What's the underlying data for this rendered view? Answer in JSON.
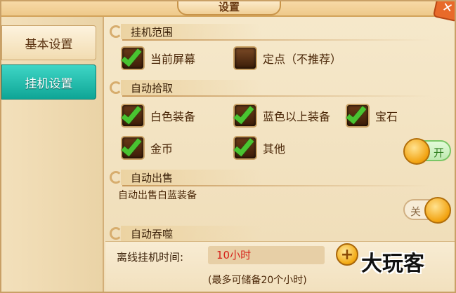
{
  "window": {
    "title": "设置",
    "close_icon": "close-icon"
  },
  "sidebar": {
    "tabs": [
      {
        "label": "基本设置",
        "active": false
      },
      {
        "label": "挂机设置",
        "active": true
      }
    ]
  },
  "sections": {
    "range": {
      "title": "挂机范围",
      "options": [
        {
          "label": "当前屏幕",
          "checked": true
        },
        {
          "label": "定点（不推荐）",
          "checked": false
        }
      ]
    },
    "pickup": {
      "title": "自动拾取",
      "options": [
        {
          "label": "白色装备",
          "checked": true
        },
        {
          "label": "蓝色以上装备",
          "checked": true
        },
        {
          "label": "宝石",
          "checked": true
        },
        {
          "label": "金币",
          "checked": true
        },
        {
          "label": "其他",
          "checked": true
        }
      ],
      "toggle": {
        "label": "开",
        "state": "on"
      }
    },
    "sell": {
      "title": "自动出售",
      "description": "自动出售白蓝装备",
      "toggle": {
        "label": "关",
        "state": "off"
      }
    },
    "devour": {
      "title": "自动吞噬"
    }
  },
  "offline": {
    "label": "离线挂机时间:",
    "value": "10小时",
    "note": "(最多可储备20个小时)",
    "add_icon": "plus-icon"
  },
  "watermark": {
    "text": "大玩客"
  },
  "colors": {
    "accent_teal": "#0fa596",
    "check_green": "#49c431",
    "value_red": "#d6221a",
    "panel_bg": "#f3e4c4"
  }
}
